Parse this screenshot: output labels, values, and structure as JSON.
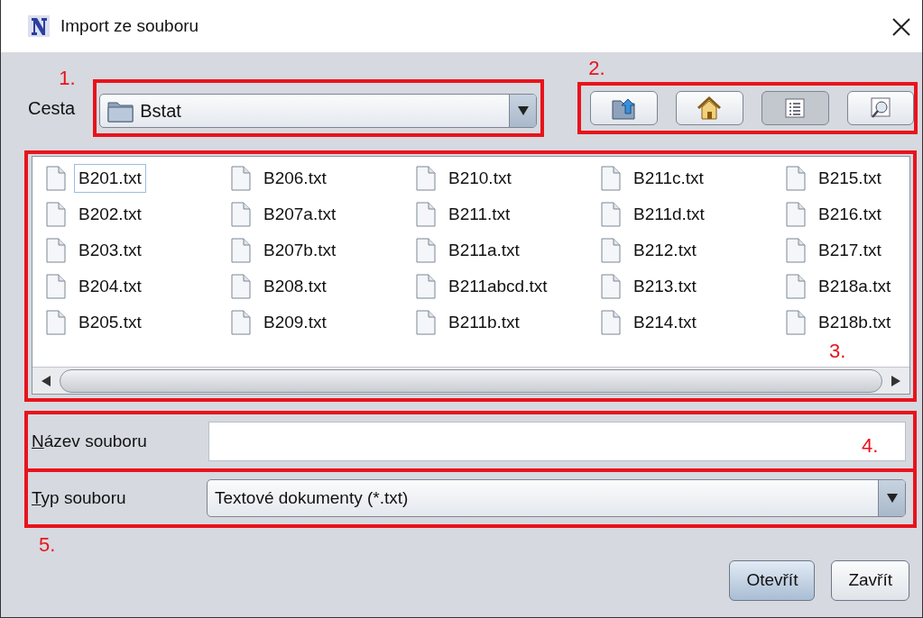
{
  "window": {
    "title": "Import ze souboru"
  },
  "path": {
    "label": "Cesta",
    "value": "Bstat",
    "annotation": "1."
  },
  "toolbar": {
    "annotation": "2.",
    "buttons": [
      {
        "kind": "up",
        "selected": false
      },
      {
        "kind": "home",
        "selected": false
      },
      {
        "kind": "list",
        "selected": true
      },
      {
        "kind": "details",
        "selected": false
      }
    ]
  },
  "files": {
    "annotation": "3.",
    "items": [
      {
        "name": "B201.txt",
        "selected": true
      },
      {
        "name": "B202.txt",
        "selected": false
      },
      {
        "name": "B203.txt",
        "selected": false
      },
      {
        "name": "B204.txt",
        "selected": false
      },
      {
        "name": "B205.txt",
        "selected": false
      },
      {
        "name": "B206.txt",
        "selected": false
      },
      {
        "name": "B207a.txt",
        "selected": false
      },
      {
        "name": "B207b.txt",
        "selected": false
      },
      {
        "name": "B208.txt",
        "selected": false
      },
      {
        "name": "B209.txt",
        "selected": false
      },
      {
        "name": "B210.txt",
        "selected": false
      },
      {
        "name": "B211.txt",
        "selected": false
      },
      {
        "name": "B211a.txt",
        "selected": false
      },
      {
        "name": "B211abcd.txt",
        "selected": false
      },
      {
        "name": "B211b.txt",
        "selected": false
      },
      {
        "name": "B211c.txt",
        "selected": false
      },
      {
        "name": "B211d.txt",
        "selected": false
      },
      {
        "name": "B212.txt",
        "selected": false
      },
      {
        "name": "B213.txt",
        "selected": false
      },
      {
        "name": "B214.txt",
        "selected": false
      },
      {
        "name": "B215.txt",
        "selected": false
      },
      {
        "name": "B216.txt",
        "selected": false
      },
      {
        "name": "B217.txt",
        "selected": false
      },
      {
        "name": "B218a.txt",
        "selected": false
      },
      {
        "name": "B218b.txt",
        "selected": false
      }
    ]
  },
  "file_name": {
    "label": {
      "mnemonic": "N",
      "rest": "ázev souboru"
    },
    "annotation": "4."
  },
  "file_type": {
    "label": {
      "mnemonic": "T",
      "rest": "yp souboru"
    },
    "value": "Textové dokumenty (*.txt)",
    "annotation": "5."
  },
  "buttons": [
    {
      "label": "Otevřít",
      "kind": "default"
    },
    {
      "label": "Zavřít",
      "kind": "normal"
    }
  ]
}
